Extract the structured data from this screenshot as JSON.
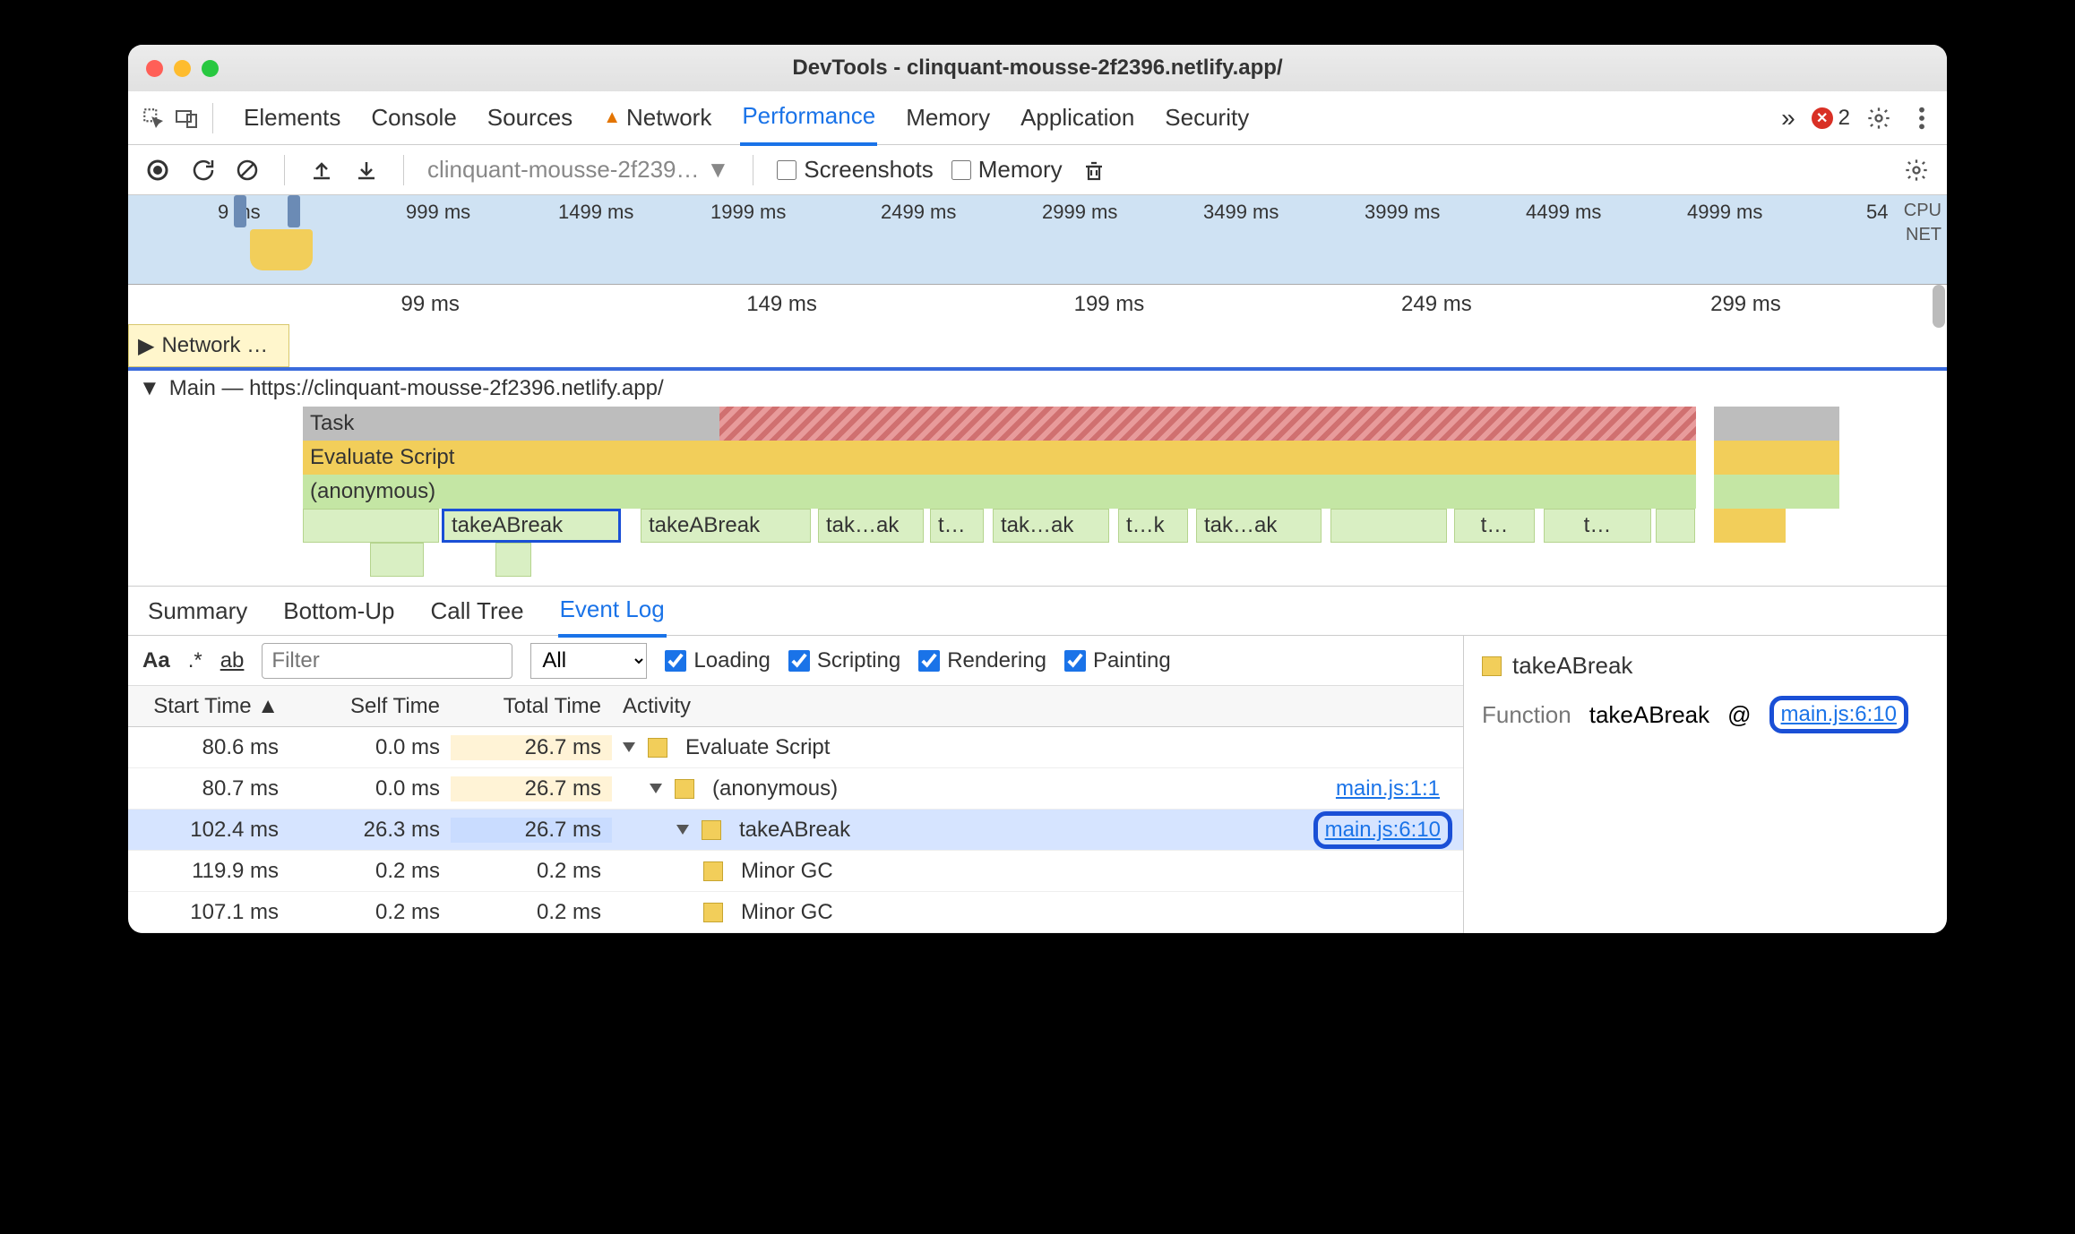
{
  "window": {
    "title": "DevTools - clinquant-mousse-2f2396.netlify.app/"
  },
  "tabs": {
    "items": [
      "Elements",
      "Console",
      "Sources",
      "Network",
      "Performance",
      "Memory",
      "Application",
      "Security"
    ],
    "active": "Performance",
    "network_warning": true,
    "overflow_glyph": "»",
    "error_count": "2"
  },
  "toolbar": {
    "url_select": "clinquant-mousse-2f239…",
    "screenshots_label": "Screenshots",
    "memory_label": "Memory"
  },
  "overview": {
    "ticks": [
      {
        "label": "9 ms",
        "pct": 5
      },
      {
        "label": "999 ms",
        "pct": 15.5
      },
      {
        "label": "1499 ms",
        "pct": 24
      },
      {
        "label": "1999 ms",
        "pct": 32.5
      },
      {
        "label": "2499 ms",
        "pct": 42
      },
      {
        "label": "2999 ms",
        "pct": 51
      },
      {
        "label": "3499 ms",
        "pct": 60
      },
      {
        "label": "3999 ms",
        "pct": 69
      },
      {
        "label": "4499 ms",
        "pct": 78
      },
      {
        "label": "4999 ms",
        "pct": 87
      },
      {
        "label": "54",
        "pct": 97
      }
    ],
    "cpu_label": "CPU",
    "net_label": "NET"
  },
  "ruler": {
    "ticks": [
      {
        "label": "99 ms",
        "pct": 15
      },
      {
        "label": "149 ms",
        "pct": 34
      },
      {
        "label": "199 ms",
        "pct": 52
      },
      {
        "label": "249 ms",
        "pct": 70
      },
      {
        "label": "299 ms",
        "pct": 87
      }
    ]
  },
  "network_track": {
    "label": "Network …"
  },
  "main_track": {
    "label": "Main — https://clinquant-mousse-2f2396.netlify.app/"
  },
  "flame": {
    "task": "Task",
    "eval": "Evaluate Script",
    "anon": "(anonymous)",
    "calls": [
      "takeABreak",
      "takeABreak",
      "tak…ak",
      "t…",
      "tak…ak",
      "t…k",
      "tak…ak",
      "t…",
      "t…"
    ]
  },
  "bottom_tabs": {
    "items": [
      "Summary",
      "Bottom-Up",
      "Call Tree",
      "Event Log"
    ],
    "active": "Event Log"
  },
  "filter": {
    "placeholder": "Filter",
    "all_label": "All",
    "loading": "Loading",
    "scripting": "Scripting",
    "rendering": "Rendering",
    "painting": "Painting"
  },
  "table": {
    "headers": {
      "start": "Start Time",
      "self": "Self Time",
      "total": "Total Time",
      "activity": "Activity"
    },
    "rows": [
      {
        "start": "80.6 ms",
        "self": "0.0 ms",
        "total": "26.7 ms",
        "total_bg": "c3bg1",
        "indent": 0,
        "disclose": true,
        "label": "Evaluate Script",
        "link": ""
      },
      {
        "start": "80.7 ms",
        "self": "0.0 ms",
        "total": "26.7 ms",
        "total_bg": "c3bg1",
        "indent": 1,
        "disclose": true,
        "label": "(anonymous)",
        "link": "main.js:1:1"
      },
      {
        "start": "102.4 ms",
        "self": "26.3 ms",
        "total": "26.7 ms",
        "total_bg": "c3bg2",
        "indent": 2,
        "disclose": true,
        "label": "takeABreak",
        "link": "main.js:6:10",
        "selected": true,
        "highlight_link": true
      },
      {
        "start": "119.9 ms",
        "self": "0.2 ms",
        "total": "0.2 ms",
        "total_bg": "",
        "indent": 3,
        "disclose": false,
        "label": "Minor GC",
        "link": ""
      },
      {
        "start": "107.1 ms",
        "self": "0.2 ms",
        "total": "0.2 ms",
        "total_bg": "",
        "indent": 3,
        "disclose": false,
        "label": "Minor GC",
        "link": ""
      }
    ]
  },
  "details": {
    "title": "takeABreak",
    "function_label": "Function",
    "function_name": "takeABreak",
    "at_glyph": "@",
    "source_link": "main.js:6:10"
  }
}
